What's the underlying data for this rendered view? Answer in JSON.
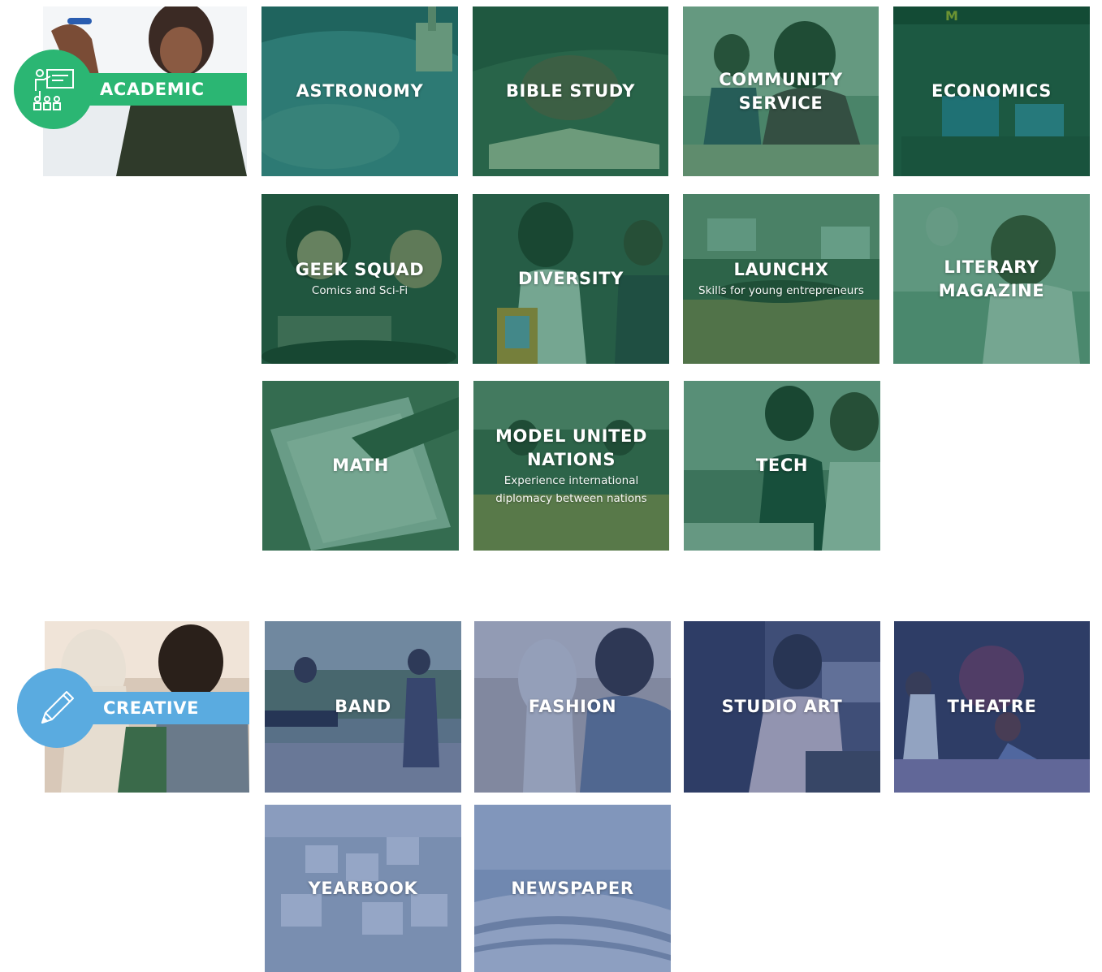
{
  "colors": {
    "academic_accent": "#2bb673",
    "creative_accent": "#5aabe0",
    "academic_overlay": "#166e48",
    "creative_overlay": "#345496"
  },
  "sections": {
    "academic": {
      "category_label": "ACADEMIC",
      "category_icon": "presentation-board-icon",
      "clubs": [
        {
          "title": "ASTRONOMY",
          "subtitle": ""
        },
        {
          "title": "BIBLE STUDY",
          "subtitle": ""
        },
        {
          "title": "COMMUNITY\nSERVICE",
          "subtitle": ""
        },
        {
          "title": "ECONOMICS",
          "subtitle": ""
        },
        {
          "title": "GEEK SQUAD",
          "subtitle": "Comics and Sci-Fi"
        },
        {
          "title": "DIVERSITY",
          "subtitle": ""
        },
        {
          "title": "LAUNCHX",
          "subtitle": "Skills for young entrepreneurs"
        },
        {
          "title": "LITERARY\nMAGAZINE",
          "subtitle": ""
        },
        {
          "title": "MATH",
          "subtitle": ""
        },
        {
          "title": "MODEL UNITED\nNATIONS",
          "subtitle": "Experience international\ndiplomacy between nations"
        },
        {
          "title": "TECH",
          "subtitle": ""
        }
      ]
    },
    "creative": {
      "category_label": "CREATIVE",
      "category_icon": "pencil-icon",
      "clubs": [
        {
          "title": "BAND",
          "subtitle": ""
        },
        {
          "title": "FASHION",
          "subtitle": ""
        },
        {
          "title": "STUDIO ART",
          "subtitle": ""
        },
        {
          "title": "THEATRE",
          "subtitle": ""
        },
        {
          "title": "YEARBOOK",
          "subtitle": ""
        },
        {
          "title": "NEWSPAPER",
          "subtitle": ""
        }
      ]
    }
  }
}
